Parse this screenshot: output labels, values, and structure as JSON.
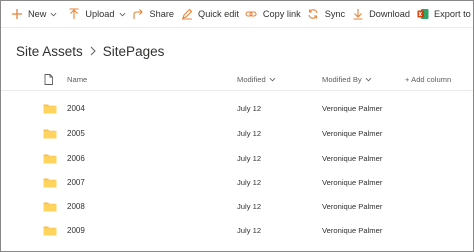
{
  "toolbar": {
    "new_label": "New",
    "upload_label": "Upload",
    "share_label": "Share",
    "quick_edit_label": "Quick edit",
    "copy_link_label": "Copy link",
    "sync_label": "Sync",
    "download_label": "Download",
    "export_label": "Export to Excel"
  },
  "breadcrumb": {
    "parent": "Site Assets",
    "current": "SitePages"
  },
  "columns": {
    "name": "Name",
    "modified": "Modified",
    "modified_by": "Modified By",
    "add_column": "+ Add column"
  },
  "rows": [
    {
      "name": "2004",
      "modified": "July 12",
      "modified_by": "Veronique Palmer"
    },
    {
      "name": "2005",
      "modified": "July 12",
      "modified_by": "Veronique Palmer"
    },
    {
      "name": "2006",
      "modified": "July 12",
      "modified_by": "Veronique Palmer"
    },
    {
      "name": "2007",
      "modified": "July 12",
      "modified_by": "Veronique Palmer"
    },
    {
      "name": "2008",
      "modified": "July 12",
      "modified_by": "Veronique Palmer"
    },
    {
      "name": "2009",
      "modified": "July 12",
      "modified_by": "Veronique Palmer"
    }
  ],
  "colors": {
    "accent": "#e8833a",
    "folder": "#f4c04f",
    "excel": "#217346"
  },
  "icons": [
    "plus-icon",
    "upload-icon",
    "share-icon",
    "quick-edit-icon",
    "copy-link-icon",
    "sync-icon",
    "download-icon",
    "excel-icon",
    "chevron-down-icon",
    "file-type-icon",
    "folder-icon"
  ]
}
